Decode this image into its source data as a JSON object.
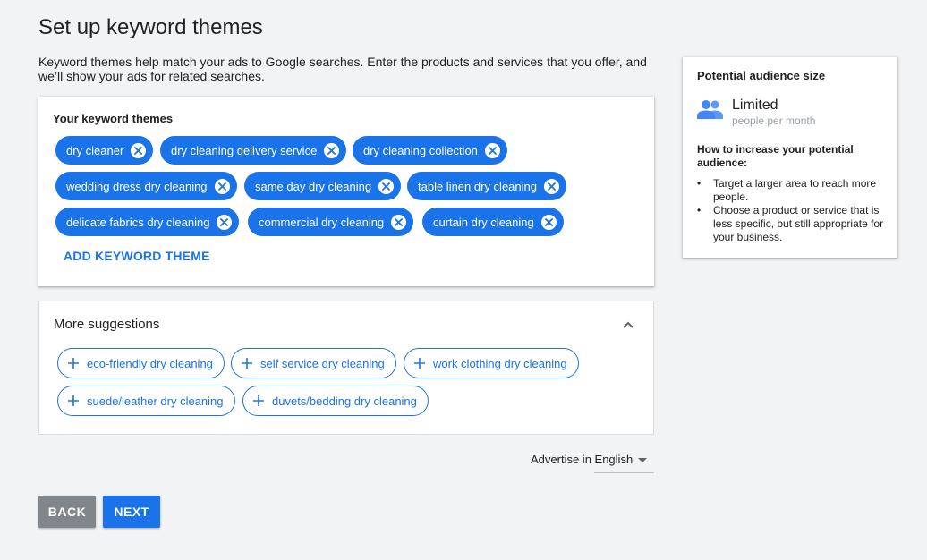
{
  "page": {
    "title": "Set up keyword themes",
    "intro": "Keyword themes help match your ads to Google searches. Enter the products and services that you offer, and we’ll show your ads for related searches."
  },
  "themes": {
    "heading": "Your keyword themes",
    "chips": [
      "dry cleaner",
      "dry cleaning delivery service",
      "dry cleaning collection",
      "wedding dress dry cleaning",
      "same day dry cleaning",
      "table linen dry cleaning",
      "delicate fabrics dry cleaning",
      "commercial dry cleaning",
      "curtain dry cleaning"
    ],
    "add_label": "ADD KEYWORD THEME"
  },
  "suggestions": {
    "heading": "More suggestions",
    "chips": [
      "eco-friendly dry cleaning",
      "self service dry cleaning",
      "work clothing dry cleaning",
      "suede/leather dry cleaning",
      "duvets/bedding dry cleaning"
    ]
  },
  "language": {
    "selected": "Advertise in English"
  },
  "buttons": {
    "back": "BACK",
    "next": "NEXT"
  },
  "audience": {
    "title": "Potential audience size",
    "value": "Limited",
    "unit": "people per month",
    "howto": "How to increase your potential audience:",
    "tips": [
      "Target a larger area to reach more people.",
      "Choose a product or service that is less specific, but still appropriate for your business."
    ]
  },
  "colors": {
    "accent": "#1a73e8",
    "back_button": "#80868b",
    "background": "#f1f3f4"
  },
  "icons": {
    "chip_remove": "close-circle-icon",
    "suggestion_add": "plus-icon",
    "collapse": "chevron-up-icon",
    "audience": "people-icon",
    "dropdown": "caret-down-icon"
  }
}
